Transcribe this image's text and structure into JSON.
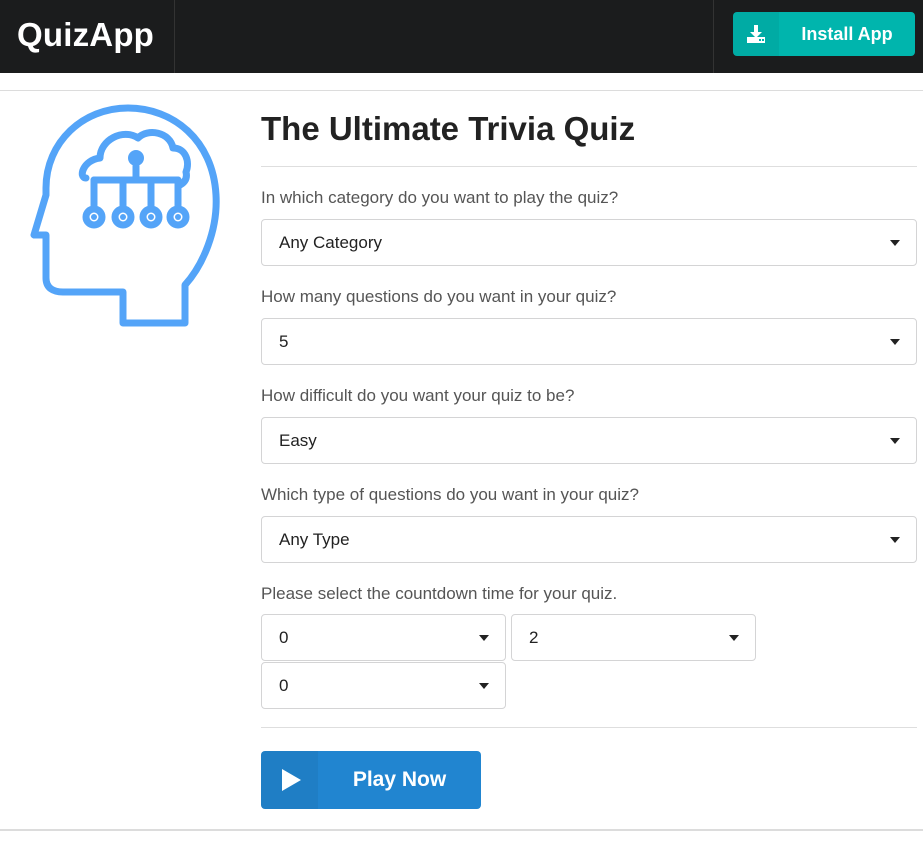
{
  "header": {
    "brand": "QuizApp",
    "install_label": "Install App",
    "install_icon": "download-icon"
  },
  "illustration": {
    "icon": "head-network-icon",
    "color": "#54a4f8"
  },
  "quiz": {
    "title": "The Ultimate Trivia Quiz",
    "category": {
      "label": "In which category do you want to play the quiz?",
      "value": "Any Category"
    },
    "amount": {
      "label": "How many questions do you want in your quiz?",
      "value": "5"
    },
    "difficulty": {
      "label": "How difficult do you want your quiz to be?",
      "value": "Easy"
    },
    "type": {
      "label": "Which type of questions do you want in your quiz?",
      "value": "Any Type"
    },
    "countdown": {
      "label": "Please select the countdown time for your quiz.",
      "hours": "0",
      "minutes": "2",
      "seconds": "0"
    },
    "play_label": "Play Now",
    "play_icon": "play-icon"
  },
  "colors": {
    "header_bg": "#1b1c1d",
    "install_btn": "#00b5ad",
    "play_btn": "#2185d0",
    "illustration": "#54a4f8"
  }
}
